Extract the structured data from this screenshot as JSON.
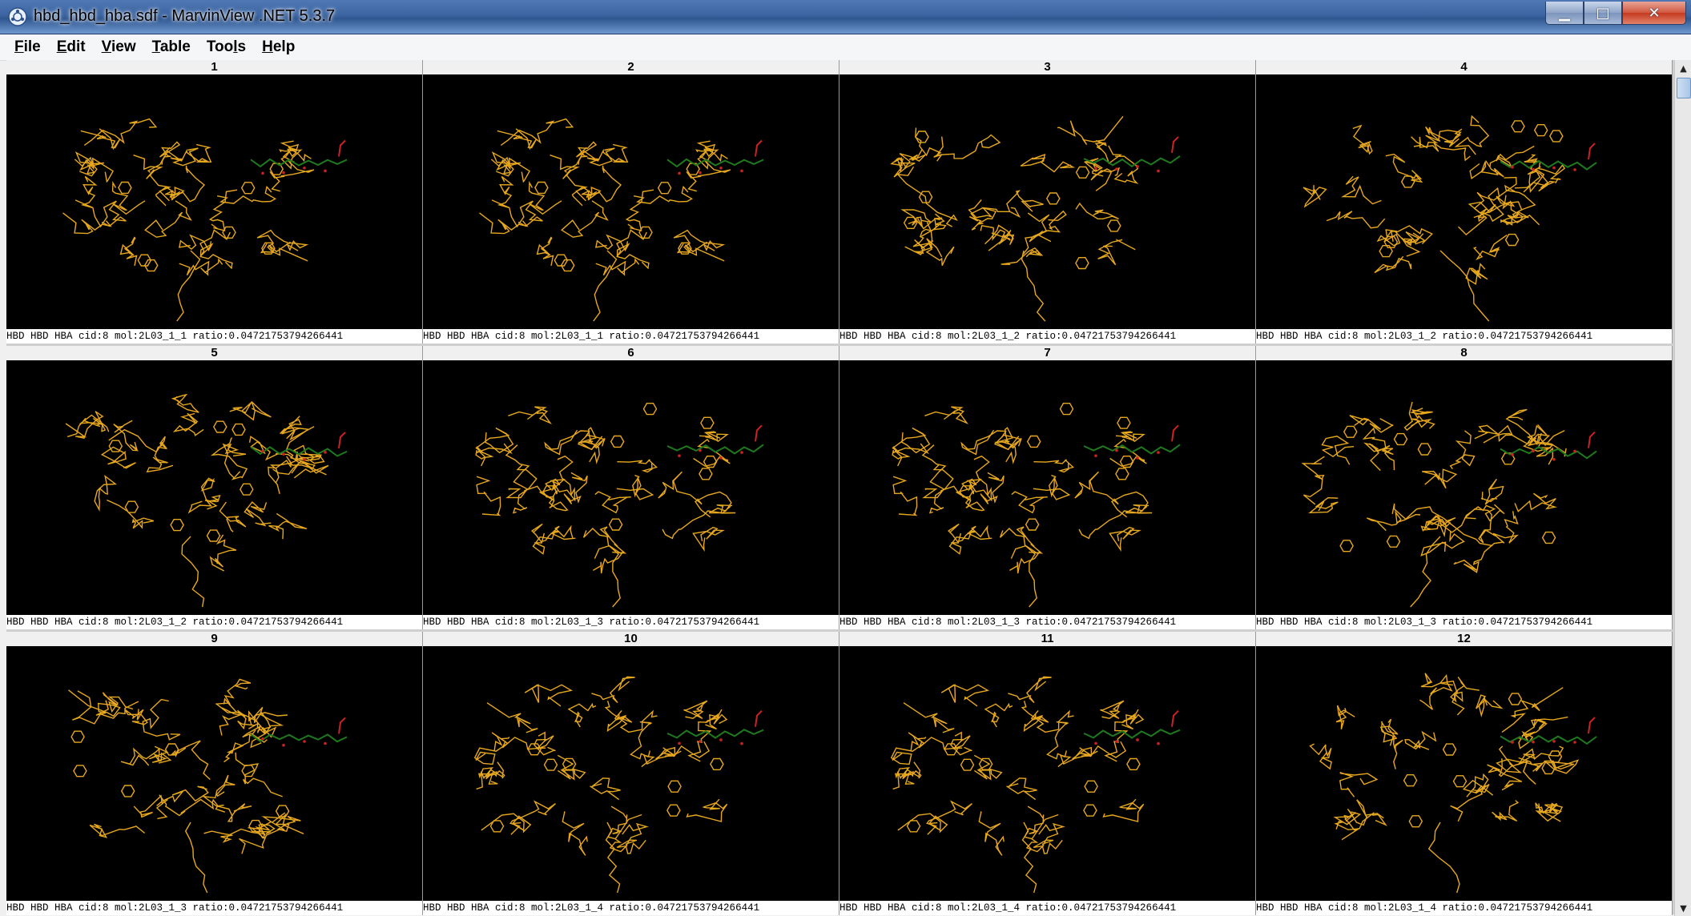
{
  "window": {
    "title": "hbd_hbd_hba.sdf - MarvinView .NET 5.3.7",
    "minimize_glyph": "▁",
    "maximize_glyph": "□",
    "close_glyph": "✕"
  },
  "menu": [
    {
      "pre": "",
      "u": "F",
      "post": "ile"
    },
    {
      "pre": "",
      "u": "E",
      "post": "dit"
    },
    {
      "pre": "",
      "u": "V",
      "post": "iew"
    },
    {
      "pre": "",
      "u": "T",
      "post": "able"
    },
    {
      "pre": "Too",
      "u": "l",
      "post": "s"
    },
    {
      "pre": "",
      "u": "H",
      "post": "elp"
    }
  ],
  "cells": [
    {
      "index": "1",
      "caption": "HBD HBD HBA cid:8 mol:2L03_1_1 ratio:0.04721753794266441"
    },
    {
      "index": "2",
      "caption": "HBD HBD HBA cid:8 mol:2L03_1_1 ratio:0.04721753794266441"
    },
    {
      "index": "3",
      "caption": "HBD HBD HBA cid:8 mol:2L03_1_2 ratio:0.04721753794266441"
    },
    {
      "index": "4",
      "caption": "HBD HBD HBA cid:8 mol:2L03_1_2 ratio:0.04721753794266441"
    },
    {
      "index": "5",
      "caption": "HBD HBD HBA cid:8 mol:2L03_1_2 ratio:0.04721753794266441"
    },
    {
      "index": "6",
      "caption": "HBD HBD HBA cid:8 mol:2L03_1_3 ratio:0.04721753794266441"
    },
    {
      "index": "7",
      "caption": "HBD HBD HBA cid:8 mol:2L03_1_3 ratio:0.04721753794266441"
    },
    {
      "index": "8",
      "caption": "HBD HBD HBA cid:8 mol:2L03_1_3 ratio:0.04721753794266441"
    },
    {
      "index": "9",
      "caption": "HBD HBD HBA cid:8 mol:2L03_1_3 ratio:0.04721753794266441"
    },
    {
      "index": "10",
      "caption": "HBD HBD HBA cid:8 mol:2L03_1_4 ratio:0.04721753794266441"
    },
    {
      "index": "11",
      "caption": "HBD HBD HBA cid:8 mol:2L03_1_4 ratio:0.04721753794266441"
    },
    {
      "index": "12",
      "caption": "HBD HBD HBA cid:8 mol:2L03_1_4 ratio:0.04721753794266441"
    }
  ],
  "colors": {
    "protein": "#e8a81e",
    "ligand": "#1f7a1f",
    "oxygen": "#cc2222",
    "background": "#000000"
  },
  "icons": {
    "app": "marvin-app-icon",
    "scroll_up": "▲",
    "scroll_down": "▼"
  }
}
